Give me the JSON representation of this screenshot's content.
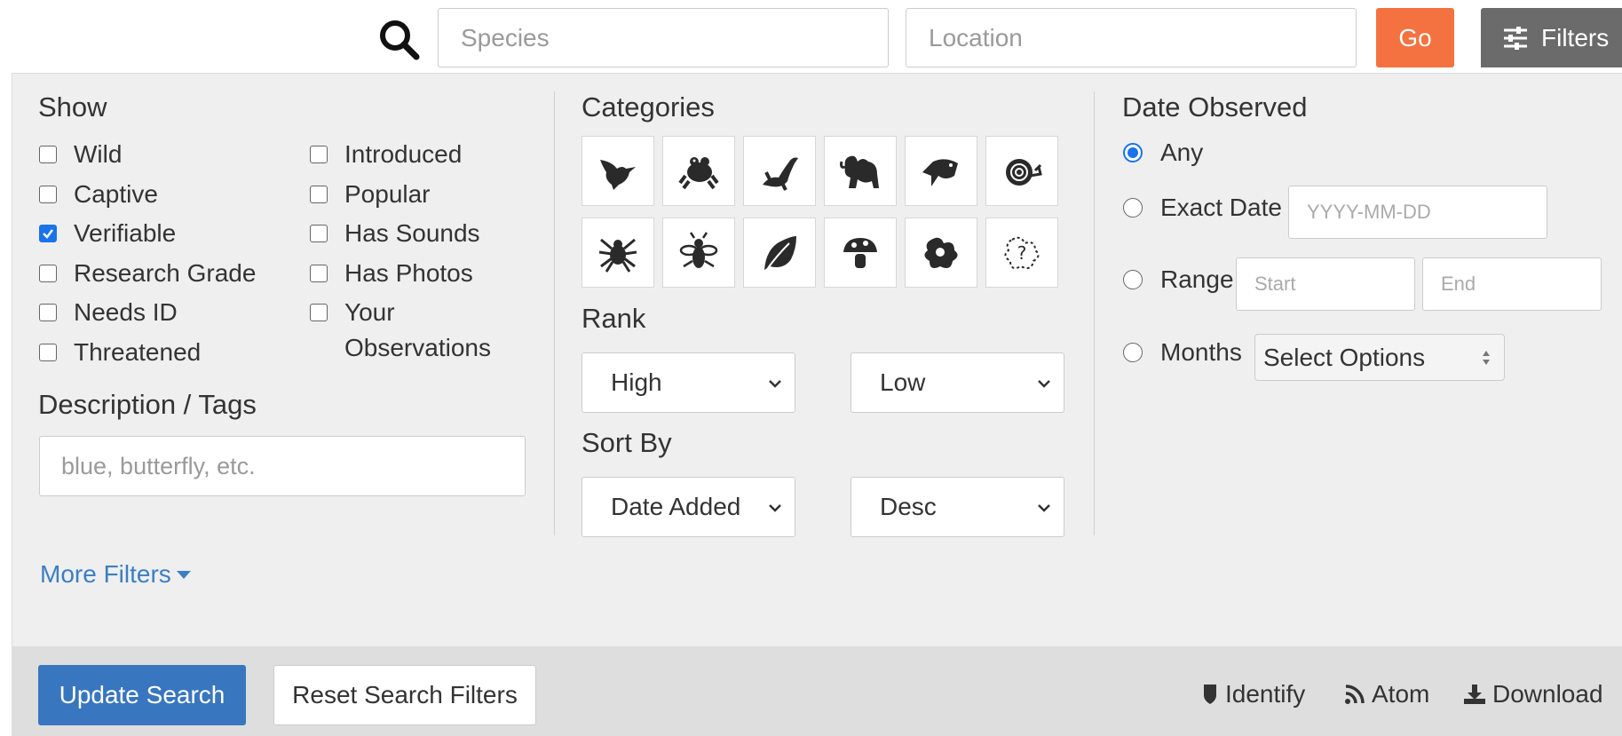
{
  "search": {
    "species_placeholder": "Species",
    "location_placeholder": "Location",
    "go_label": "Go",
    "filters_label": "Filters"
  },
  "show": {
    "heading": "Show",
    "left": [
      {
        "label": "Wild",
        "checked": false
      },
      {
        "label": "Captive",
        "checked": false
      },
      {
        "label": "Verifiable",
        "checked": true
      },
      {
        "label": "Research Grade",
        "checked": false
      },
      {
        "label": "Needs ID",
        "checked": false
      },
      {
        "label": "Threatened",
        "checked": false
      }
    ],
    "right": [
      {
        "label": "Introduced",
        "checked": false
      },
      {
        "label": "Popular",
        "checked": false
      },
      {
        "label": "Has Sounds",
        "checked": false
      },
      {
        "label": "Has Photos",
        "checked": false
      },
      {
        "label": "Your",
        "checked": false
      },
      {
        "label": "Observations"
      }
    ]
  },
  "description": {
    "heading": "Description / Tags",
    "placeholder": "blue, butterfly, etc."
  },
  "categories": {
    "heading": "Categories",
    "icons": [
      "bird-icon",
      "amphibian-icon",
      "reptile-icon",
      "mammal-icon",
      "fish-icon",
      "mollusk-icon",
      "spider-icon",
      "insect-icon",
      "plant-icon",
      "fungi-icon",
      "protozoa-icon",
      "unknown-icon"
    ]
  },
  "rank": {
    "heading": "Rank",
    "high": "High",
    "low": "Low"
  },
  "sort": {
    "heading": "Sort By",
    "field": "Date Added",
    "order": "Desc"
  },
  "date": {
    "heading": "Date Observed",
    "any": "Any",
    "exact": "Exact Date",
    "exact_placeholder": "YYYY-MM-DD",
    "range": "Range",
    "start_placeholder": "Start",
    "end_placeholder": "End",
    "months": "Months",
    "months_select": "Select Options",
    "selected": "any"
  },
  "more_filters": "More Filters",
  "footer": {
    "update": "Update Search",
    "reset": "Reset Search Filters",
    "identify": "Identify",
    "atom": "Atom",
    "download": "Download"
  },
  "colors": {
    "go": "#f37240",
    "update": "#3876bf",
    "link": "#3b7fc2",
    "checked": "#1a73e8"
  }
}
